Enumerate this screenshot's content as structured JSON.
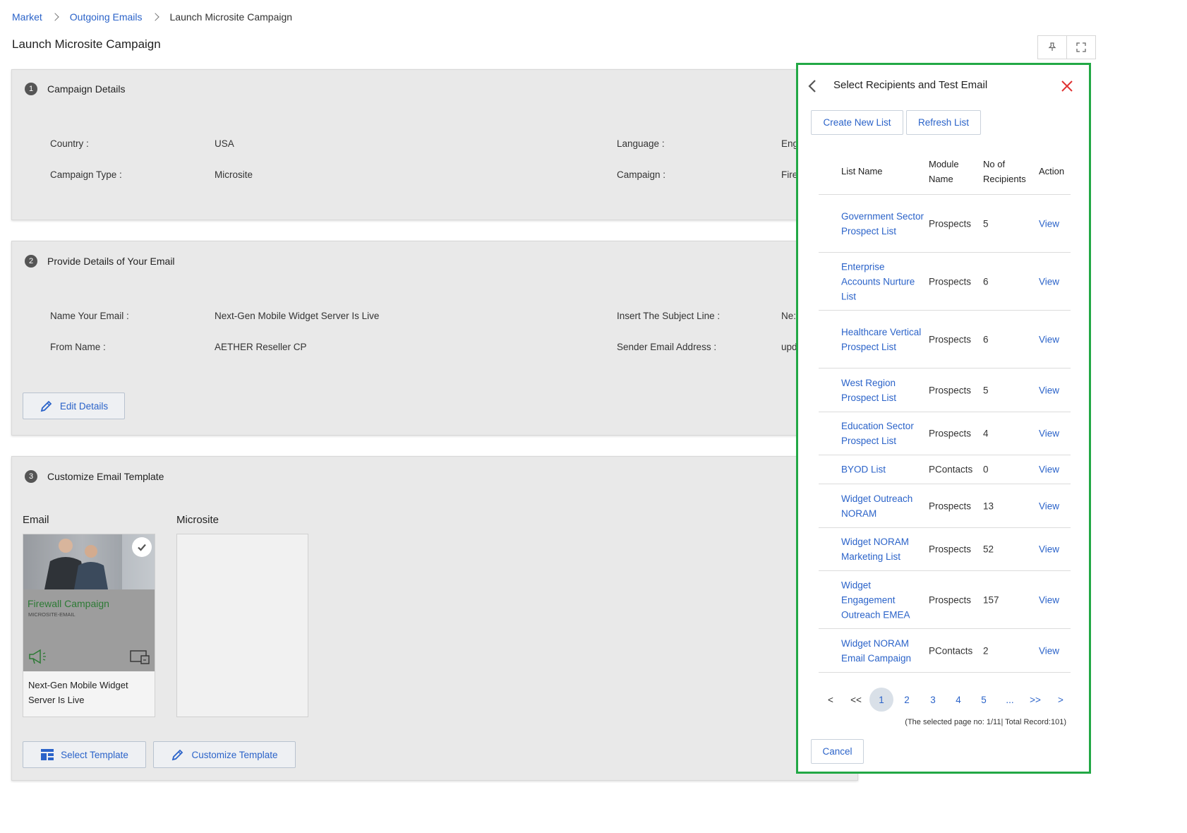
{
  "breadcrumb": [
    "Market",
    "Outgoing Emails",
    "Launch Microsite Campaign"
  ],
  "page_title": "Launch Microsite Campaign",
  "sections": {
    "campaign": {
      "number": "1",
      "title": "Campaign Details",
      "fields": [
        {
          "label": "Country :",
          "value": "USA"
        },
        {
          "label": "Language :",
          "value": "Eng"
        },
        {
          "label": "Campaign Type :",
          "value": "Microsite"
        },
        {
          "label": "Campaign :",
          "value": "Fire"
        }
      ]
    },
    "email": {
      "number": "2",
      "title": "Provide Details of Your Email",
      "fields": [
        {
          "label": "Name Your Email :",
          "value": "Next-Gen Mobile Widget Server Is Live"
        },
        {
          "label": "Insert The Subject Line :",
          "value": "Ne:"
        },
        {
          "label": "From Name :",
          "value": "AETHER Reseller CP"
        },
        {
          "label": "Sender Email Address :",
          "value": "upd"
        }
      ],
      "edit_button": "Edit Details"
    },
    "template": {
      "number": "3",
      "title": "Customize Email Template",
      "email_col": "Email",
      "microsite_col": "Microsite",
      "card": {
        "thumb_title": "Firewall Campaign",
        "thumb_subtitle": "MICROSITE-EMAIL",
        "caption": "Next-Gen Mobile Widget Server Is Live"
      },
      "select_button": "Select Template",
      "customize_button": "Customize Template"
    }
  },
  "drawer": {
    "title": "Select Recipients and Test Email",
    "create_button": "Create New List",
    "refresh_button": "Refresh List",
    "columns": {
      "list_name": "List Name",
      "module_name": "Module Name",
      "recipients": "No of Recipients",
      "action": "Action"
    },
    "rows": [
      {
        "name": "Government Sector Prospect List",
        "module": "Prospects",
        "count": "5",
        "action": "View"
      },
      {
        "name": "Enterprise Accounts Nurture List",
        "module": "Prospects",
        "count": "6",
        "action": "View"
      },
      {
        "name": "Healthcare Vertical Prospect List",
        "module": "Prospects",
        "count": "6",
        "action": "View"
      },
      {
        "name": "West Region Prospect List",
        "module": "Prospects",
        "count": "5",
        "action": "View"
      },
      {
        "name": "Education Sector Prospect List",
        "module": "Prospects",
        "count": "4",
        "action": "View"
      },
      {
        "name": "BYOD List",
        "module": "PContacts",
        "count": "0",
        "action": "View"
      },
      {
        "name": "Widget Outreach NORAM",
        "module": "Prospects",
        "count": "13",
        "action": "View"
      },
      {
        "name": "Widget NORAM Marketing List",
        "module": "Prospects",
        "count": "52",
        "action": "View"
      },
      {
        "name": "Widget Engagement Outreach EMEA",
        "module": "Prospects",
        "count": "157",
        "action": "View"
      },
      {
        "name": "Widget NORAM Email Campaign",
        "module": "PContacts",
        "count": "2",
        "action": "View"
      }
    ],
    "pagination": {
      "prev": "<",
      "first": "<<",
      "pages": [
        "1",
        "2",
        "3",
        "4",
        "5"
      ],
      "ellipsis": "...",
      "last": ">>",
      "next": ">",
      "info": "(The selected page no: 1/11| Total Record:101)"
    },
    "cancel_button": "Cancel"
  },
  "colors": {
    "link": "#2b63c9",
    "drawer_border": "#22a845",
    "close": "#e03131"
  }
}
